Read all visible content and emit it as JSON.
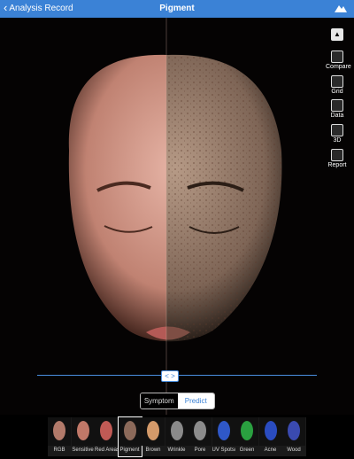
{
  "header": {
    "back_label": "Analysis Record",
    "title": "Pigment"
  },
  "toolbar": {
    "collapse_icon": "chevron-up",
    "items": [
      {
        "label": "Compare",
        "icon": "compare-icon"
      },
      {
        "label": "Grid",
        "icon": "grid-icon"
      },
      {
        "label": "Data",
        "icon": "data-icon"
      },
      {
        "label": "3D",
        "icon": "cube-icon"
      },
      {
        "label": "Report",
        "icon": "report-icon"
      }
    ]
  },
  "compare": {
    "handle_glyph": "< >"
  },
  "mode": {
    "symptom": "Symptom",
    "predict": "Predict",
    "selected": "Predict"
  },
  "thumbnails": [
    {
      "label": "RGB",
      "color": "#b27a6a"
    },
    {
      "label": "Sensitive",
      "color": "#c07868"
    },
    {
      "label": "Red Areas",
      "color": "#c05a55"
    },
    {
      "label": "Pigment",
      "color": "#8c6a5a",
      "selected": true
    },
    {
      "label": "Brown",
      "color": "#d49a6a"
    },
    {
      "label": "Wrinkle",
      "color": "#8a8a8a"
    },
    {
      "label": "Pore",
      "color": "#8c8c8c"
    },
    {
      "label": "UV Spots/perPigment",
      "color": "#2f58c8"
    },
    {
      "label": "Green",
      "color": "#2aa040"
    },
    {
      "label": "Acne",
      "color": "#2a4cc0"
    },
    {
      "label": "Wood",
      "color": "#3a4ab0"
    }
  ],
  "colors": {
    "accent": "#3b82d6",
    "background": "#000000"
  }
}
